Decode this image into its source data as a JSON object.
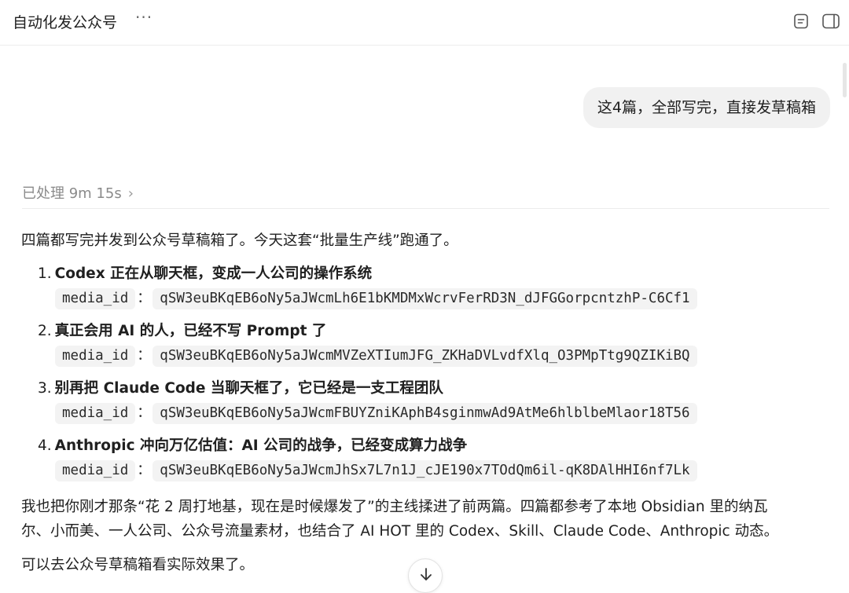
{
  "window": {
    "title": "自动化发公众号",
    "more_label": "···"
  },
  "icons": {
    "notes": "notes-icon",
    "sidebar": "sidebar-toggle-icon",
    "scroll": "arrow-down-icon"
  },
  "conversation": {
    "user_message": "这4篇，全部写完，直接发草稿箱",
    "processed_label": "已处理 9m 15s",
    "processed_chevron": "›",
    "intro": "四篇都写完并发到公众号草稿箱了。今天这套“批量生产线”跑通了。",
    "articles": [
      {
        "number": "1.",
        "title": "Codex 正在从聊天框，变成一人公司的操作系统",
        "media_label": "media_id",
        "media_id": "qSW3euBKqEB6oNy5aJWcmLh6E1bKMDMxWcrvFerRD3N_dJFGGorpcntzhP-C6Cf1"
      },
      {
        "number": "2.",
        "title": "真正会用 AI 的人，已经不写 Prompt 了",
        "media_label": "media_id",
        "media_id": "qSW3euBKqEB6oNy5aJWcmMVZeXTIumJFG_ZKHaDVLvdfXlq_O3PMpTtg9QZIKiBQ"
      },
      {
        "number": "3.",
        "title": "别再把 Claude Code 当聊天框了，它已经是一支工程团队",
        "media_label": "media_id",
        "media_id": "qSW3euBKqEB6oNy5aJWcmFBUYZniKAphB4sginmwAd9AtMe6hlblbeMlaor18T56"
      },
      {
        "number": "4.",
        "title": "Anthropic 冲向万亿估值：AI 公司的战争，已经变成算力战争",
        "media_label": "media_id",
        "media_id": "qSW3euBKqEB6oNy5aJWcmJhSx7L7n1J_cJE190x7TOdQm6il-qK8DAlHHI6nf7Lk"
      }
    ],
    "para_line1": "我也把你刚才那条“花 2 周打地基，现在是时候爆发了”的主线揉进了前两篇。四篇都参考了本地 Obsidian 里的纳瓦",
    "para_line2": "尔、小而美、一人公司、公众号流量素材，也结合了 AI HOT 里的 Codex、Skill、Claude Code、Anthropic 动态。",
    "closing": "可以去公众号草稿箱看实际效果了。"
  }
}
